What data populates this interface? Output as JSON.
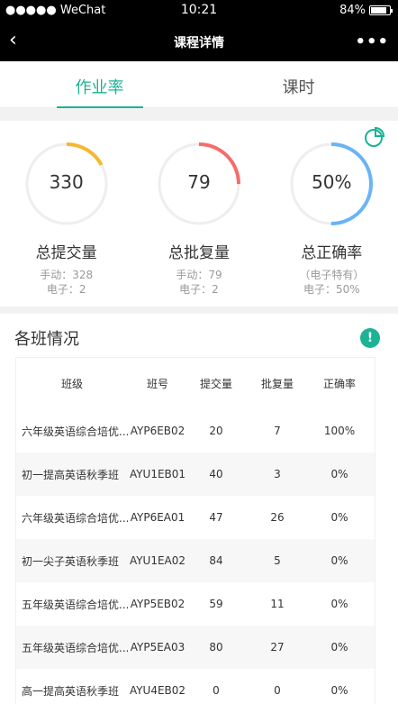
{
  "status": {
    "signal": "●●●●● WeChat",
    "time": "10:21",
    "battery": "84%",
    "battery_level": 0.84
  },
  "nav": {
    "back": "‹",
    "title": "课程详情",
    "more": "•••"
  },
  "tabs": [
    {
      "label": "作业率",
      "active": true
    },
    {
      "label": "课时",
      "active": false
    }
  ],
  "stats": [
    {
      "value": "330",
      "label": "总提交量",
      "sub1": "手动：328",
      "sub2": "电子：2",
      "color": "#f7b731",
      "progress": 0.17
    },
    {
      "value": "79",
      "label": "总批复量",
      "sub1": "手动：79",
      "sub2": "电子：2",
      "color": "#f76b6b",
      "progress": 0.25
    },
    {
      "value": "50%",
      "label": "总正确率",
      "sub1": "（电子特有）",
      "sub2": "电子：50%",
      "color": "#69b4f7",
      "progress": 0.5
    }
  ],
  "class_section": {
    "title": "各班情况",
    "headers": [
      "班级",
      "班号",
      "提交量",
      "批复量",
      "正确率"
    ],
    "rows": [
      [
        "六年级英语综合培优...",
        "AYP6EB02",
        "20",
        "7",
        "100%"
      ],
      [
        "初一提高英语秋季班",
        "AYU1EB01",
        "40",
        "3",
        "0%"
      ],
      [
        "六年级英语综合培优...",
        "AYP6EA01",
        "47",
        "26",
        "0%"
      ],
      [
        "初一尖子英语秋季班",
        "AYU1EA02",
        "84",
        "5",
        "0%"
      ],
      [
        "五年级英语综合培优...",
        "AYP5EB02",
        "59",
        "11",
        "0%"
      ],
      [
        "五年级英语综合培优...",
        "AYP5EA03",
        "80",
        "27",
        "0%"
      ],
      [
        "高一提高英语秋季班",
        "AYU4EB02",
        "0",
        "0",
        "0%"
      ]
    ]
  }
}
